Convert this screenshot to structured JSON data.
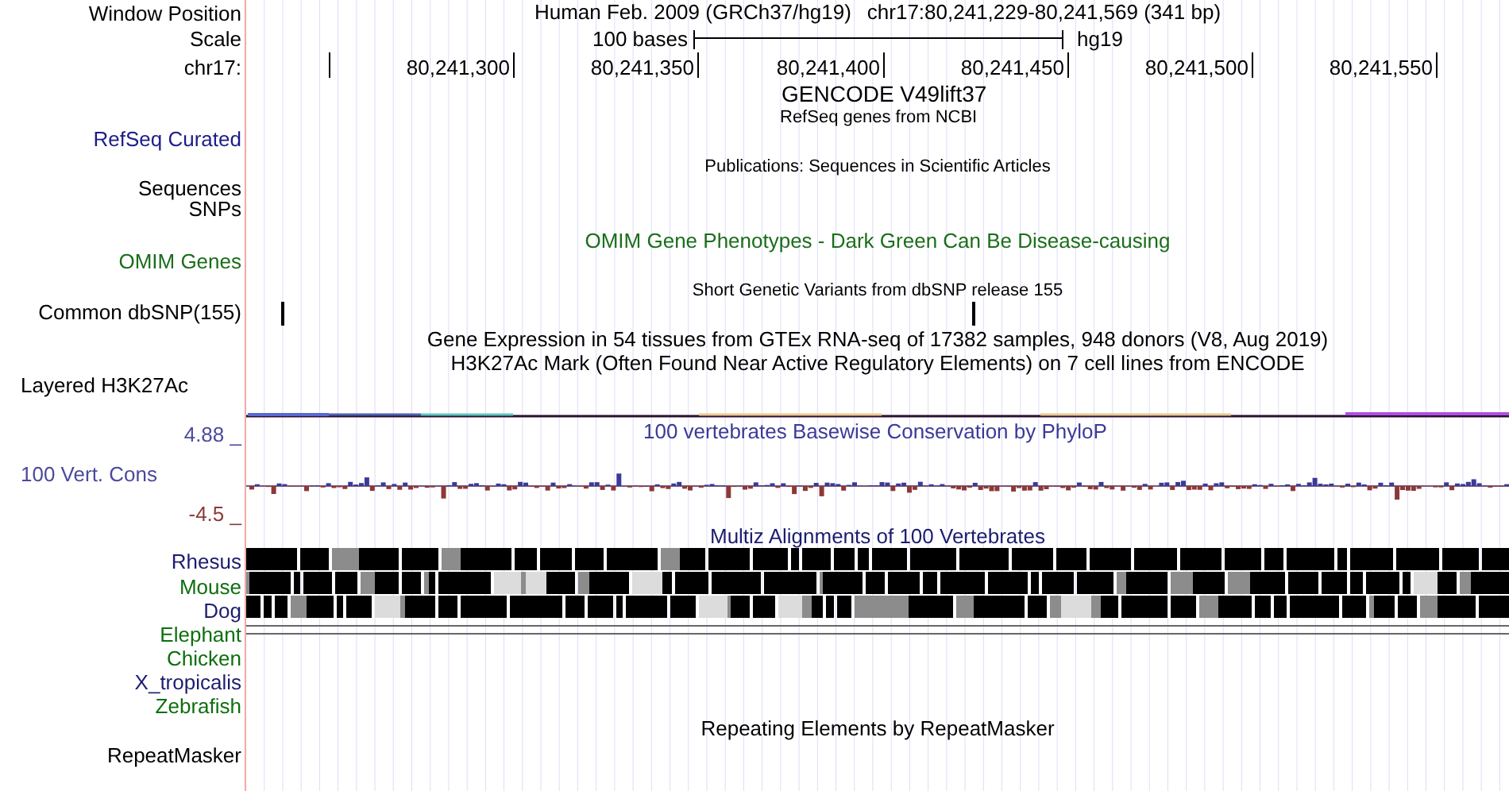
{
  "labels": [
    {
      "text": "Window Position",
      "kind": "track",
      "color": "#000000"
    },
    {
      "text": "Scale",
      "kind": "track",
      "color": "#000000"
    },
    {
      "text": "chr17:",
      "kind": "track",
      "color": "#000000"
    },
    {
      "text": "RefSeq Curated",
      "kind": "track",
      "color": "#1c1c88"
    },
    {
      "text": "Sequences",
      "kind": "track",
      "color": "#000000"
    },
    {
      "text": "SNPs",
      "kind": "track",
      "color": "#000000"
    },
    {
      "text": "OMIM Genes",
      "kind": "track",
      "color": "#1a6e1a"
    },
    {
      "text": "Common dbSNP(155)",
      "kind": "track",
      "color": "#000000"
    },
    {
      "text": "Layered H3K27Ac",
      "kind": "composite",
      "color": "#000000"
    },
    {
      "text": "4.88 _",
      "kind": "track",
      "color": "#4a4a9c"
    },
    {
      "text": "100 Vert. Cons",
      "kind": "composite",
      "color": "#4a4a9c"
    },
    {
      "text": "-4.5 _",
      "kind": "track",
      "color": "#8c3a3a"
    },
    {
      "text": "Rhesus",
      "kind": "track",
      "color": "#1c1c70"
    },
    {
      "text": "Mouse",
      "kind": "track",
      "color": "#0e6e0e"
    },
    {
      "text": "Dog",
      "kind": "track",
      "color": "#1c1c70"
    },
    {
      "text": "Elephant",
      "kind": "track",
      "color": "#0e6e0e"
    },
    {
      "text": "Chicken",
      "kind": "track",
      "color": "#0e6e0e"
    },
    {
      "text": "X_tropicalis",
      "kind": "track",
      "color": "#1c1c70"
    },
    {
      "text": "Zebrafish",
      "kind": "track",
      "color": "#0e6e0e"
    },
    {
      "text": "RepeatMasker",
      "kind": "track",
      "color": "#000000"
    }
  ],
  "header": {
    "assembly": "Human Feb. 2009 (GRCh37/hg19)",
    "position": "chr17:80,241,229-80,241,569 (341 bp)"
  },
  "scale": {
    "label": "100 bases",
    "assembly": "hg19"
  },
  "ruler": {
    "ticks": [
      "80,241,300",
      "80,241,350",
      "80,241,400",
      "80,241,450",
      "80,241,500",
      "80,241,550"
    ]
  },
  "gencode_title": "GENCODE V49lift37",
  "refseq_title": "RefSeq genes from NCBI",
  "publications_title": "Publications: Sequences in Scientific Articles",
  "omim_title": "OMIM Gene Phenotypes - Dark Green Can Be Disease-causing",
  "dbsnp_title": "Short Genetic Variants from dbSNP release 155",
  "gtex_title": "Gene Expression in 54 tissues from GTEx RNA-seq of 17382 samples, 948 donors (V8, Aug 2019)",
  "h3k27ac_title": "H3K27Ac Mark (Often Found Near Active Regulatory Elements) on 7 cell lines from ENCODE",
  "phylop_title": "100 vertebrates Basewise Conservation by PhyloP",
  "multiz_title": "Multiz Alignments of 100 Vertebrates",
  "repeatmasker_title": "Repeating Elements by RepeatMasker"
}
